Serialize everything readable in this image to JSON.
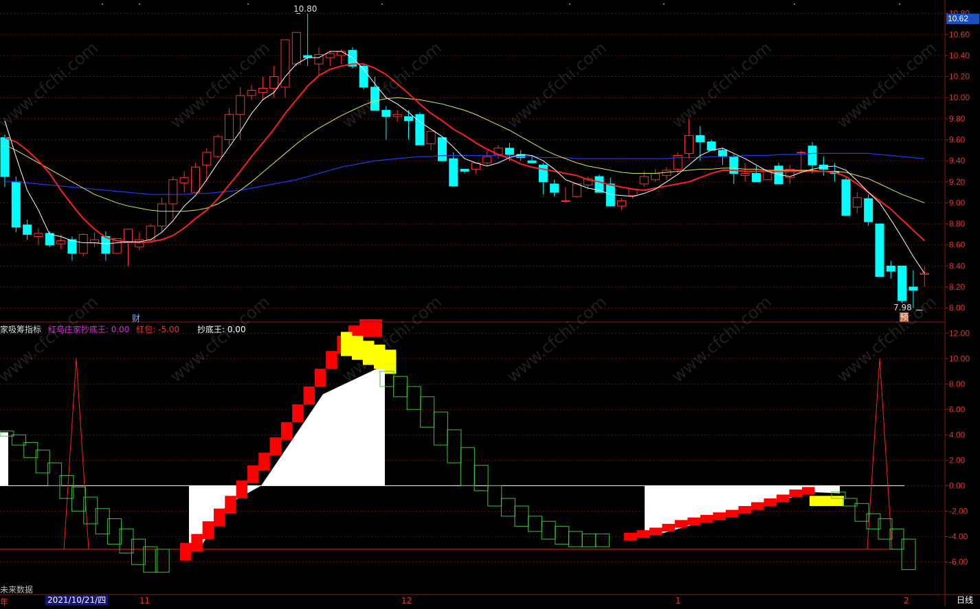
{
  "main_chart": {
    "high_label": "10.80",
    "low_label": "7.98",
    "current_price": "10.62",
    "finance_marker": "财",
    "forecast_marker": "预"
  },
  "sub_chart": {
    "name": "家吸筹指标",
    "red_bird_label": "红鸟庄家抄底王: 0.00",
    "red_packet_label": "红包: -5.00",
    "bottom_king_label": "抄底王: 0.00"
  },
  "axis": {
    "left_price_partial": "年",
    "future_label": "未来数据",
    "selected_date": "2021/10/21/四",
    "months": [
      "11",
      "12",
      "1",
      "2"
    ],
    "period": "日线"
  },
  "watermark": "www.cfchi.com",
  "colors": {
    "up": "#ff3232",
    "down": "#00ffff",
    "ma5": "#ffffff",
    "ma10": "#ff2020",
    "ma20": "#e6e64a",
    "ma60": "#1e3cff",
    "grid": "#8b1a1a",
    "bg": "#000000",
    "block_red": "#ff0000",
    "block_yellow": "#ffff00",
    "block_white": "#ffffff",
    "box_green": "#3ac43a"
  },
  "chart_data": [
    {
      "type": "candlestick",
      "title": "",
      "ylim": [
        7.9,
        10.85
      ],
      "yticks": [
        8.0,
        8.2,
        8.4,
        8.6,
        8.8,
        9.0,
        9.2,
        9.4,
        9.6,
        9.8,
        10.0,
        10.2,
        10.4,
        10.6,
        10.8
      ],
      "series_ohlc": [
        [
          9.62,
          9.65,
          9.15,
          9.25
        ],
        [
          9.2,
          9.25,
          8.72,
          8.77
        ],
        [
          8.79,
          8.84,
          8.65,
          8.7
        ],
        [
          8.68,
          8.76,
          8.6,
          8.71
        ],
        [
          8.71,
          8.73,
          8.58,
          8.6
        ],
        [
          8.61,
          8.7,
          8.56,
          8.64
        ],
        [
          8.65,
          8.68,
          8.45,
          8.52
        ],
        [
          8.52,
          8.71,
          8.49,
          8.7
        ],
        [
          8.62,
          8.72,
          8.58,
          8.65
        ],
        [
          8.68,
          8.73,
          8.45,
          8.52
        ],
        [
          8.52,
          8.66,
          8.52,
          8.66
        ],
        [
          8.62,
          8.71,
          8.4,
          8.75
        ],
        [
          8.58,
          8.72,
          8.55,
          8.65
        ],
        [
          8.65,
          8.8,
          8.62,
          8.78
        ],
        [
          8.78,
          9.05,
          8.73,
          8.99
        ],
        [
          8.99,
          9.25,
          8.85,
          9.22
        ],
        [
          9.19,
          9.3,
          9.1,
          9.24
        ],
        [
          9.1,
          9.38,
          9.1,
          9.34
        ],
        [
          9.36,
          9.52,
          9.2,
          9.48
        ],
        [
          9.44,
          9.65,
          9.42,
          9.63
        ],
        [
          9.6,
          9.9,
          9.55,
          9.84
        ],
        [
          9.84,
          10.1,
          9.6,
          10.02
        ],
        [
          10.02,
          10.12,
          9.98,
          10.07
        ],
        [
          10.05,
          10.2,
          9.98,
          10.09
        ],
        [
          10.09,
          10.3,
          10.0,
          10.2
        ],
        [
          10.1,
          10.5,
          10.0,
          10.55
        ],
        [
          10.32,
          10.62,
          10.3,
          10.62
        ],
        [
          10.4,
          10.8,
          10.3,
          10.38
        ],
        [
          10.32,
          10.48,
          10.2,
          10.41
        ],
        [
          10.38,
          10.45,
          10.3,
          10.42
        ],
        [
          10.4,
          10.46,
          10.32,
          10.44
        ],
        [
          10.45,
          10.48,
          10.28,
          10.3
        ],
        [
          10.3,
          10.32,
          10.08,
          10.1
        ],
        [
          10.1,
          10.2,
          9.88,
          9.88
        ],
        [
          9.88,
          9.92,
          9.6,
          9.82
        ],
        [
          9.82,
          9.88,
          9.77,
          9.84
        ],
        [
          9.82,
          9.88,
          9.6,
          9.78
        ],
        [
          9.84,
          9.86,
          9.55,
          9.55
        ],
        [
          9.56,
          9.68,
          9.5,
          9.68
        ],
        [
          9.62,
          9.62,
          9.4,
          9.4
        ],
        [
          9.42,
          9.48,
          9.15,
          9.16
        ],
        [
          9.32,
          9.32,
          9.28,
          9.3
        ],
        [
          9.32,
          9.38,
          9.28,
          9.38
        ],
        [
          9.38,
          9.5,
          9.35,
          9.44
        ],
        [
          9.46,
          9.55,
          9.42,
          9.52
        ],
        [
          9.52,
          9.57,
          9.4,
          9.46
        ],
        [
          9.46,
          9.5,
          9.4,
          9.43
        ],
        [
          9.4,
          9.45,
          9.38,
          9.38
        ],
        [
          9.36,
          9.38,
          9.08,
          9.2
        ],
        [
          9.18,
          9.22,
          9.06,
          9.1
        ],
        [
          9.02,
          9.15,
          9.0,
          9.02
        ],
        [
          9.06,
          9.18,
          9.05,
          9.18
        ],
        [
          9.17,
          9.25,
          9.13,
          9.23
        ],
        [
          9.25,
          9.27,
          9.1,
          9.1
        ],
        [
          9.18,
          9.24,
          9.04,
          8.97
        ],
        [
          8.97,
          9.04,
          8.93,
          9.02
        ],
        [
          9.07,
          9.14,
          9.04,
          9.13
        ],
        [
          9.18,
          9.3,
          9.15,
          9.25
        ],
        [
          9.22,
          9.32,
          9.2,
          9.28
        ],
        [
          9.26,
          9.34,
          9.22,
          9.31
        ],
        [
          9.32,
          9.48,
          9.28,
          9.45
        ],
        [
          9.47,
          9.8,
          9.42,
          9.64
        ],
        [
          9.64,
          9.73,
          9.4,
          9.58
        ],
        [
          9.58,
          9.6,
          9.5,
          9.5
        ],
        [
          9.5,
          9.52,
          9.36,
          9.44
        ],
        [
          9.44,
          9.46,
          9.18,
          9.28
        ],
        [
          9.26,
          9.38,
          9.2,
          9.28
        ],
        [
          9.28,
          9.35,
          9.2,
          9.2
        ],
        [
          9.22,
          9.3,
          9.22,
          9.3
        ],
        [
          9.35,
          9.38,
          9.18,
          9.18
        ],
        [
          9.24,
          9.36,
          9.18,
          9.32
        ],
        [
          9.48,
          9.5,
          9.3,
          9.48
        ],
        [
          9.54,
          9.58,
          9.28,
          9.36
        ],
        [
          9.36,
          9.44,
          9.26,
          9.32
        ],
        [
          9.3,
          9.38,
          9.2,
          9.28
        ],
        [
          9.22,
          9.24,
          8.88,
          8.88
        ],
        [
          8.96,
          9.1,
          8.9,
          9.05
        ],
        [
          9.04,
          9.08,
          8.78,
          8.82
        ],
        [
          8.8,
          8.8,
          8.3,
          8.3
        ],
        [
          8.4,
          8.45,
          8.28,
          8.35
        ],
        [
          8.4,
          8.4,
          8.05,
          8.07
        ],
        [
          8.2,
          8.36,
          8.0,
          8.17
        ],
        [
          8.32,
          8.4,
          8.2,
          8.33
        ]
      ],
      "ma5": [
        9.78,
        9.44,
        9.12,
        8.93,
        8.7,
        8.68,
        8.64,
        8.62,
        8.62,
        8.61,
        8.62,
        8.63,
        8.63,
        8.65,
        8.72,
        8.83,
        8.97,
        9.07,
        9.22,
        9.38,
        9.53,
        9.68,
        9.85,
        9.98,
        10.05,
        10.2,
        10.32,
        10.38,
        10.38,
        10.44,
        10.44,
        10.38,
        10.27,
        10.13,
        10.0,
        9.94,
        9.86,
        9.77,
        9.7,
        9.63,
        9.53,
        9.42,
        9.38,
        9.35,
        9.38,
        9.43,
        9.46,
        9.45,
        9.4,
        9.32,
        9.22,
        9.18,
        9.14,
        9.12,
        9.08,
        9.07,
        9.06,
        9.09,
        9.13,
        9.2,
        9.27,
        9.36,
        9.45,
        9.5,
        9.52,
        9.47,
        9.42,
        9.36,
        9.3,
        9.27,
        9.25,
        9.29,
        9.32,
        9.34,
        9.35,
        9.31,
        9.21,
        9.1,
        9.0,
        8.84,
        8.67,
        8.49,
        8.33
      ],
      "ma10": [
        9.62,
        9.58,
        9.5,
        9.4,
        9.28,
        9.12,
        8.98,
        8.85,
        8.75,
        8.67,
        8.64,
        8.63,
        8.62,
        8.63,
        8.65,
        8.69,
        8.76,
        8.85,
        8.93,
        9.04,
        9.17,
        9.3,
        9.44,
        9.57,
        9.7,
        9.85,
        9.98,
        10.11,
        10.21,
        10.27,
        10.3,
        10.32,
        10.32,
        10.28,
        10.22,
        10.13,
        10.04,
        9.94,
        9.85,
        9.78,
        9.7,
        9.64,
        9.57,
        9.51,
        9.46,
        9.42,
        9.37,
        9.34,
        9.32,
        9.3,
        9.28,
        9.26,
        9.22,
        9.2,
        9.17,
        9.15,
        9.13,
        9.12,
        9.14,
        9.16,
        9.18,
        9.2,
        9.24,
        9.28,
        9.31,
        9.31,
        9.3,
        9.3,
        9.3,
        9.3,
        9.3,
        9.3,
        9.3,
        9.3,
        9.29,
        9.25,
        9.18,
        9.1,
        9.02,
        8.94,
        8.84,
        8.74,
        8.64
      ],
      "ma20": [
        9.55,
        9.5,
        9.44,
        9.38,
        9.32,
        9.26,
        9.2,
        9.14,
        9.08,
        9.04,
        9.0,
        8.97,
        8.95,
        8.93,
        8.92,
        8.92,
        8.92,
        8.93,
        8.95,
        8.99,
        9.05,
        9.12,
        9.2,
        9.29,
        9.38,
        9.47,
        9.56,
        9.64,
        9.71,
        9.77,
        9.83,
        9.88,
        9.93,
        9.97,
        9.99,
        10.0,
        9.99,
        9.98,
        9.96,
        9.94,
        9.91,
        9.88,
        9.84,
        9.79,
        9.74,
        9.69,
        9.63,
        9.57,
        9.51,
        9.46,
        9.42,
        9.38,
        9.35,
        9.33,
        9.31,
        9.29,
        9.28,
        9.28,
        9.28,
        9.29,
        9.3,
        9.31,
        9.32,
        9.32,
        9.33,
        9.33,
        9.32,
        9.32,
        9.31,
        9.31,
        9.31,
        9.31,
        9.31,
        9.3,
        9.3,
        9.29,
        9.26,
        9.23,
        9.18,
        9.13,
        9.08,
        9.04,
        9.0
      ],
      "ma60": [
        9.2,
        9.2,
        9.19,
        9.18,
        9.17,
        9.16,
        9.15,
        9.14,
        9.13,
        9.12,
        9.11,
        9.1,
        9.09,
        9.08,
        9.08,
        9.08,
        9.08,
        9.09,
        9.09,
        9.1,
        9.11,
        9.12,
        9.14,
        9.16,
        9.18,
        9.2,
        9.22,
        9.25,
        9.28,
        9.31,
        9.34,
        9.36,
        9.38,
        9.4,
        9.41,
        9.42,
        9.43,
        9.44,
        9.44,
        9.45,
        9.45,
        9.45,
        9.45,
        9.45,
        9.45,
        9.44,
        9.44,
        9.44,
        9.43,
        9.43,
        9.43,
        9.42,
        9.42,
        9.42,
        9.42,
        9.42,
        9.42,
        9.42,
        9.42,
        9.42,
        9.43,
        9.43,
        9.43,
        9.44,
        9.44,
        9.44,
        9.45,
        9.45,
        9.45,
        9.46,
        9.46,
        9.46,
        9.47,
        9.47,
        9.47,
        9.47,
        9.47,
        9.47,
        9.46,
        9.45,
        9.44,
        9.43,
        9.42
      ]
    },
    {
      "type": "bar",
      "title": "",
      "ylim": [
        -7.0,
        12.5
      ],
      "yticks": [
        -6.0,
        -4.0,
        -2.0,
        0.0,
        2.0,
        4.0,
        6.0,
        8.0,
        10.0,
        12.0
      ],
      "green_boxes": [
        [
          3.9,
          4.3
        ],
        [
          3.2,
          4.0
        ],
        [
          2.2,
          3.4
        ],
        [
          1.0,
          2.8
        ],
        [
          0.0,
          1.8
        ],
        [
          -1.0,
          0.8
        ],
        [
          -2.0,
          -0.1
        ],
        [
          -3.0,
          -0.9
        ],
        [
          -3.8,
          -1.8
        ],
        [
          -4.6,
          -2.6
        ],
        [
          -5.3,
          -3.4
        ],
        [
          -6.2,
          -4.2
        ],
        [
          -6.8,
          -4.8
        ],
        [
          -6.8,
          -5.0
        ],
        [
          7.8,
          9.0
        ],
        [
          7.0,
          8.6
        ],
        [
          6.0,
          7.8
        ],
        [
          4.6,
          7.0
        ],
        [
          3.2,
          5.8
        ],
        [
          1.8,
          4.4
        ],
        [
          0.0,
          3.0
        ],
        [
          -0.4,
          1.6
        ],
        [
          -1.6,
          0.0
        ],
        [
          -2.4,
          -1.0
        ],
        [
          -3.2,
          -1.6
        ],
        [
          -3.6,
          -2.4
        ],
        [
          -4.2,
          -2.8
        ],
        [
          -4.6,
          -3.2
        ],
        [
          -4.8,
          -3.6
        ],
        [
          -4.8,
          -3.8
        ],
        [
          -4.8,
          -3.8
        ],
        [
          -1.0,
          -0.5
        ],
        [
          -1.6,
          -1.0
        ],
        [
          -2.8,
          -1.4
        ],
        [
          -3.4,
          -2.2
        ],
        [
          -4.2,
          -2.6
        ],
        [
          -5.0,
          -3.4
        ],
        [
          -6.6,
          -4.2
        ]
      ],
      "red_steps": [
        -5.9,
        -5.2,
        -4.2,
        -3.2,
        -2.2,
        -1.0,
        0.2,
        1.2,
        2.4,
        3.6,
        5.0,
        6.4,
        7.8,
        9.2,
        10.4,
        11.2,
        11.7,
        11.7
      ],
      "red_flat": [
        -4.2,
        -4.0,
        -3.8,
        -3.5,
        -3.2,
        -3.0,
        -2.8,
        -2.6,
        -2.4,
        -2.1,
        -1.8,
        -1.5,
        -1.2,
        -0.8,
        -0.6
      ],
      "yellow_top": [
        11.4,
        11.1,
        10.7,
        10.4,
        10.0
      ],
      "red_spike_value": 10.0
    }
  ]
}
